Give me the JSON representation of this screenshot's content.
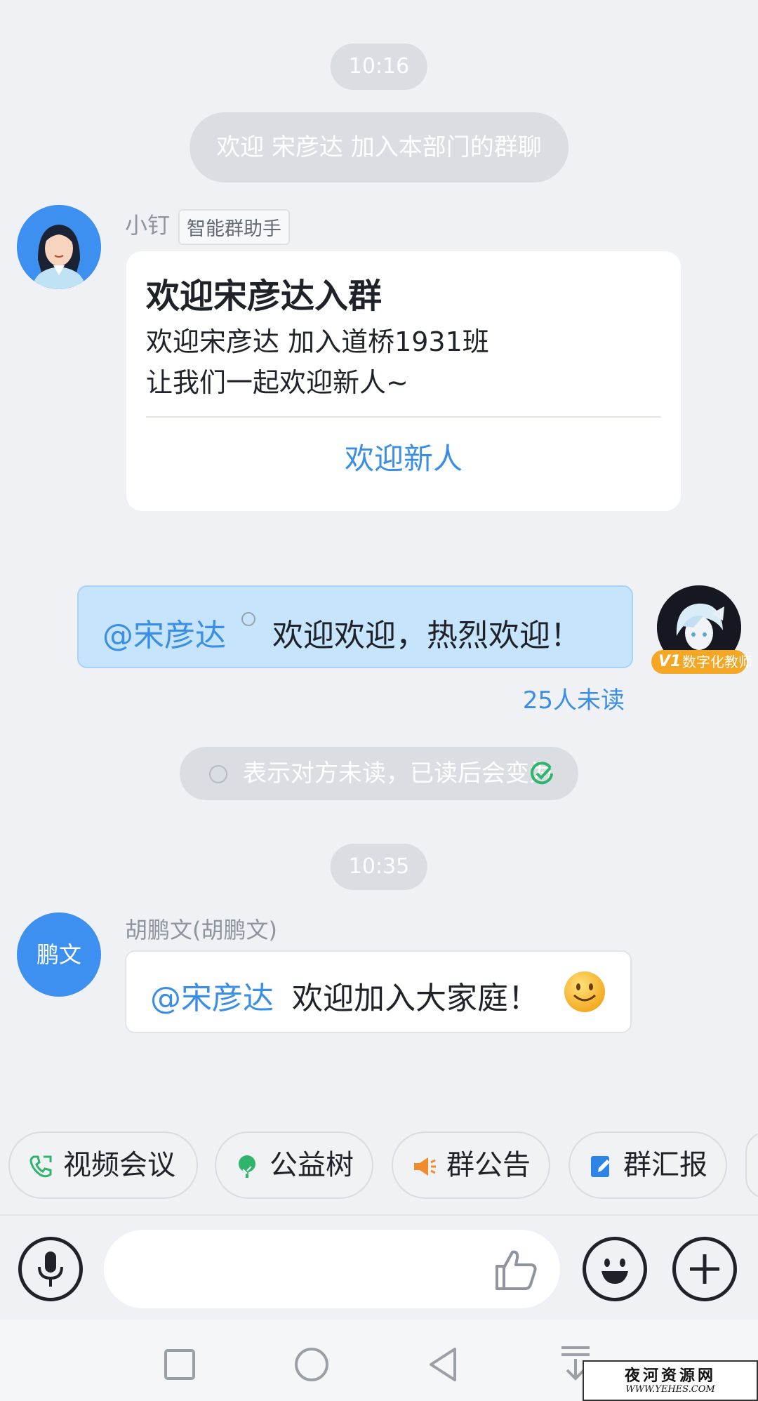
{
  "times": {
    "first": "10:16",
    "second": "10:35"
  },
  "system": {
    "join_notice": "欢迎 宋彦达 加入本部门的群聊",
    "read_hint": "表示对方未读，已读后会变为"
  },
  "bot_message": {
    "sender": "小钉",
    "tag": "智能群助手",
    "card_title": "欢迎宋彦达入群",
    "line1": "欢迎宋彦达 加入道桥1931班",
    "line2": "让我们一起欢迎新人~",
    "action": "欢迎新人"
  },
  "self_message": {
    "mention": "@宋彦达",
    "text": "欢迎欢迎，热烈欢迎！",
    "badge_level": "V1",
    "badge_label": "数字化教师",
    "unread": "25人未读"
  },
  "other_message": {
    "avatar_text": "鹏文",
    "sender": "胡鹏文(胡鹏文)",
    "mention": "@宋彦达",
    "text": "欢迎加入大家庭！",
    "emoji": "🙂"
  },
  "quick_actions": [
    {
      "label": "视频会议",
      "icon": "video-call-icon",
      "color": "#2fb56b"
    },
    {
      "label": "公益树",
      "icon": "tree-icon",
      "color": "#2fb56b"
    },
    {
      "label": "群公告",
      "icon": "megaphone-icon",
      "color": "#f08c2e"
    },
    {
      "label": "群汇报",
      "icon": "report-icon",
      "color": "#2d83e6"
    }
  ],
  "input": {
    "placeholder": ""
  },
  "watermark": {
    "title": "夜河资源网",
    "url": "WWW.YEHES.COM"
  },
  "colors": {
    "accent": "#3a8ee6",
    "self_bubble": "#c6e4fb",
    "avatar_blue": "#3d8ff0"
  }
}
